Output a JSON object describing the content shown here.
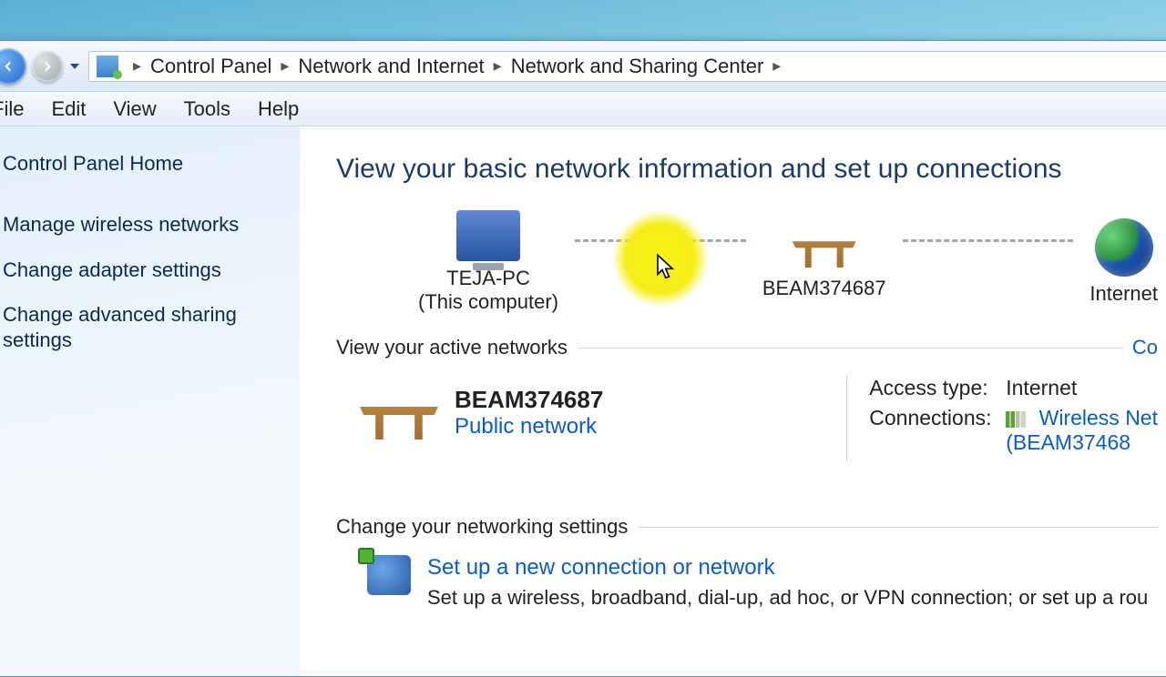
{
  "breadcrumb": {
    "p1": "Control Panel",
    "p2": "Network and Internet",
    "p3": "Network and Sharing Center"
  },
  "menu": {
    "file": "File",
    "edit": "Edit",
    "view": "View",
    "tools": "Tools",
    "help": "Help"
  },
  "sidebar": {
    "home": "Control Panel Home",
    "links": [
      "Manage wireless networks",
      "Change adapter settings",
      "Change advanced sharing settings"
    ]
  },
  "content": {
    "title": "View your basic network information and set up connections",
    "map": {
      "pc": "TEJA-PC",
      "pc_sub": "(This computer)",
      "router": "BEAM374687",
      "internet": "Internet"
    },
    "active_section": "View your active networks",
    "corner_link": "Co",
    "active": {
      "name": "BEAM374687",
      "type": "Public network",
      "access_k": "Access type:",
      "access_v": "Internet",
      "conn_k": "Connections:",
      "conn_v1": "Wireless Net",
      "conn_v2": "(BEAM37468"
    },
    "change_section": "Change your networking settings",
    "opt1_t": "Set up a new connection or network",
    "opt1_d": "Set up a wireless, broadband, dial-up, ad hoc, or VPN connection; or set up a rou"
  }
}
